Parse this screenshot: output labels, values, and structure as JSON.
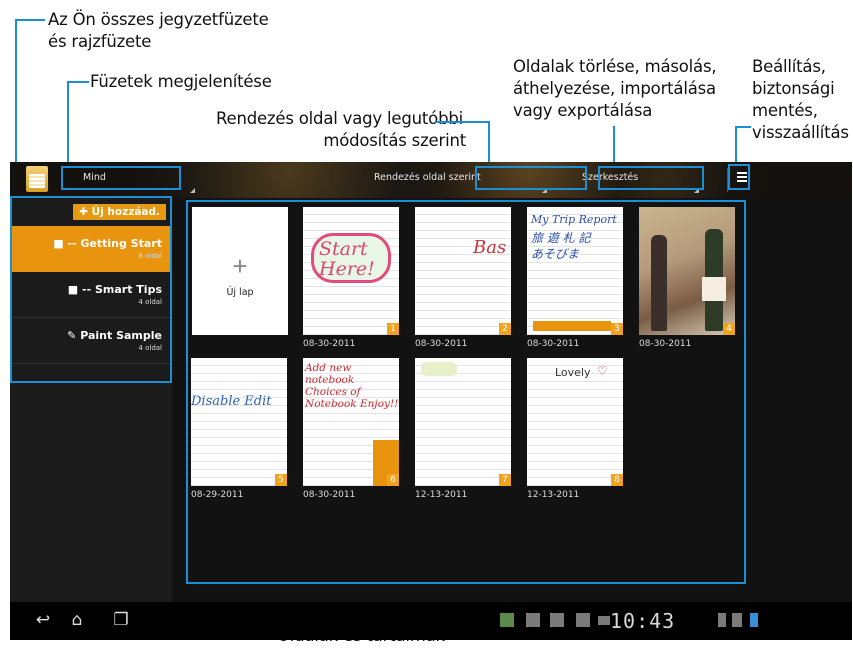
{
  "annotations": {
    "all_notebooks": "Az Ön összes jegyzetfüzete\nés rajzfüzete",
    "all_notebooks_1": "Az Ön összes jegyzetfüzete",
    "all_notebooks_2": "és rajzfüzete",
    "show_notebooks": "Füzetek megjelenítése",
    "sort_1": "Rendezés oldal vagy legutóbbi",
    "sort_2": "módosítás szerint",
    "edit_1": "Oldalak törlése, másolás,",
    "edit_2": "áthelyezése, importálása",
    "edit_3": "vagy exportálása",
    "settings_1": "Beállítás,",
    "settings_2": "biztonsági",
    "settings_3": "mentés,",
    "settings_4": "visszaállítás",
    "pages": "Oldalak és tartalmak"
  },
  "actionbar": {
    "filter_value": "Mind",
    "sort_value": "Rendezés oldal szerint",
    "edit_value": "Szerkesztés"
  },
  "sidebar": {
    "add_label": "Új hozzáad.",
    "notebooks": [
      {
        "title": "-- Getting Start",
        "count": "8 oldal",
        "icon": "square-icon"
      },
      {
        "title": "-- Smart Tips",
        "count": "4 oldal",
        "icon": "square-icon"
      },
      {
        "title": "Paint Sample",
        "count": "4 oldal",
        "icon": "paint-icon"
      }
    ]
  },
  "pages": {
    "new_page_label": "Új lap",
    "items": [
      {
        "num": "1",
        "date": "08-30-2011",
        "text": "Start Here!"
      },
      {
        "num": "2",
        "date": "08-30-2011",
        "text": "Bas"
      },
      {
        "num": "3",
        "date": "08-30-2011",
        "text": "My Trip Report"
      },
      {
        "num": "4",
        "date": "08-30-2011",
        "text": ""
      },
      {
        "num": "5",
        "date": "08-29-2011",
        "text": "Disable Edit"
      },
      {
        "num": "6",
        "date": "08-30-2011",
        "text": "Add new notebook Choices of Notebook Enjoy!!"
      },
      {
        "num": "7",
        "date": "12-13-2011",
        "text": ""
      },
      {
        "num": "8",
        "date": "12-13-2011",
        "text": "Lovely"
      }
    ]
  },
  "statusbar": {
    "time": "10:43"
  },
  "colors": {
    "accent": "#1a8fd6",
    "orange": "#e8940f"
  }
}
